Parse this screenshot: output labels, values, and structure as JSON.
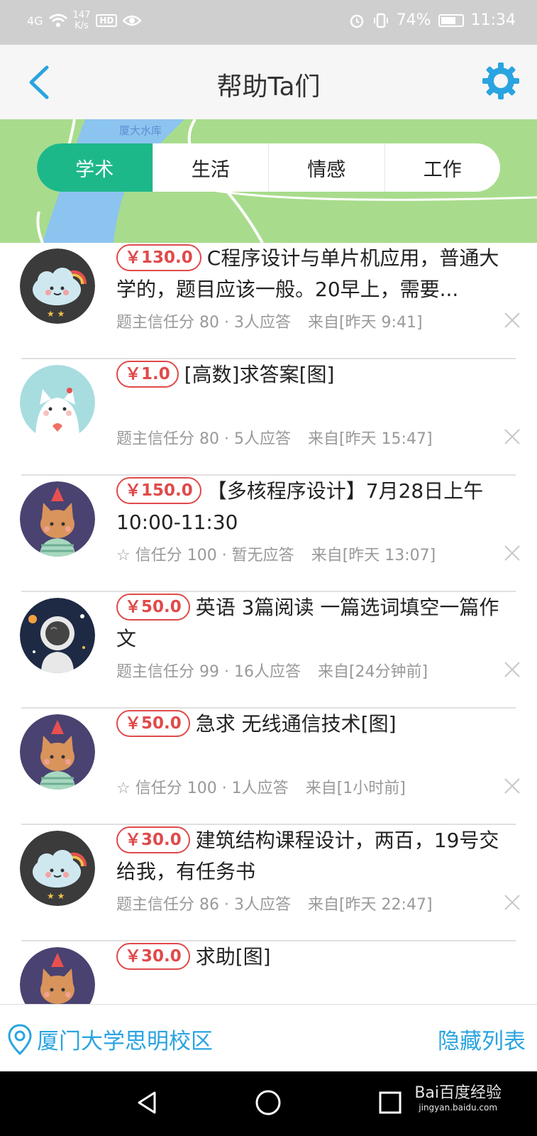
{
  "status_bar": {
    "signal": "4G",
    "speed": "147",
    "speed_unit": "K/s",
    "hd": "HD",
    "battery": "74%",
    "battery_level": 0.74,
    "time": "11:34"
  },
  "header": {
    "title": "帮助Ta们",
    "back_icon": "chevron-left-icon",
    "settings_icon": "gear-icon"
  },
  "map": {
    "label": "厦大水库"
  },
  "tabs": [
    {
      "label": "学术",
      "active": true
    },
    {
      "label": "生活",
      "active": false
    },
    {
      "label": "情感",
      "active": false
    },
    {
      "label": "工作",
      "active": false
    }
  ],
  "items": [
    {
      "price": "￥130.0",
      "title": "C程序设计与单片机应用，普通大学的，题目应该一般。20早上，需要...",
      "meta": "题主信任分 80 · 3人应答",
      "from": "来自[昨天 9:41]",
      "avatar": "cloud-avatar"
    },
    {
      "price": "￥1.0",
      "title": "[高数]求答案[图]",
      "meta": "题主信任分 80 · 5人应答",
      "from": "来自[昨天 15:47]",
      "avatar": "white-cat-avatar"
    },
    {
      "price": "￥150.0",
      "title": "【多核程序设计】7月28日上午10:00-11:30",
      "meta": "☆ 信任分 100 · 暂无应答",
      "from": "来自[昨天 13:07]",
      "avatar": "party-cat-avatar"
    },
    {
      "price": "￥50.0",
      "title": "英语 3篇阅读 一篇选词填空一篇作文",
      "meta": "题主信任分 99 · 16人应答",
      "from": "来自[24分钟前]",
      "avatar": "astronaut-avatar"
    },
    {
      "price": "￥50.0",
      "title": "急求 无线通信技术[图]",
      "meta": "☆ 信任分 100 · 1人应答",
      "from": "来自[1小时前]",
      "avatar": "party-cat-avatar"
    },
    {
      "price": "￥30.0",
      "title": "建筑结构课程设计，两百，19号交给我，有任务书",
      "meta": "题主信任分 86 · 3人应答",
      "from": "来自[昨天 22:47]",
      "avatar": "cloud-avatar"
    },
    {
      "price": "￥30.0",
      "title": "求助[图]",
      "meta": "",
      "from": "",
      "avatar": "party-cat-avatar"
    }
  ],
  "bottom_bar": {
    "location": "厦门大学思明校区",
    "hide_list": "隐藏列表"
  },
  "watermark": {
    "brand": "Bai百度经验",
    "url": "jingyan.baidu.com"
  }
}
